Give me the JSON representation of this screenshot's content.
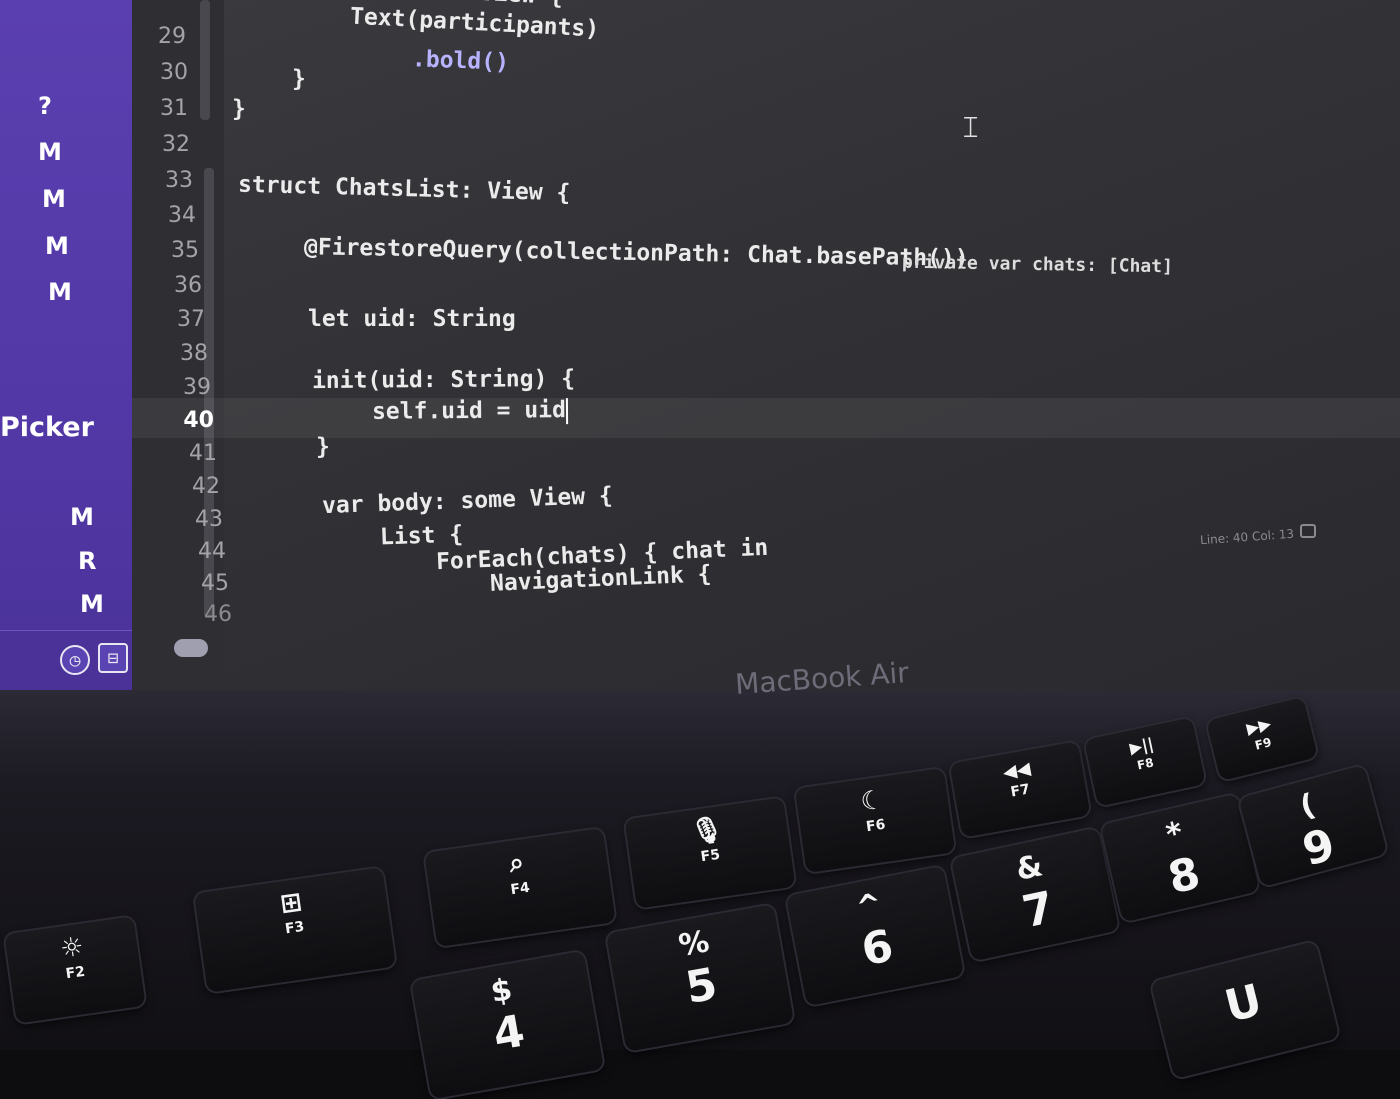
{
  "navigator": {
    "status_badges": [
      "?",
      "M",
      "M",
      "M",
      "M"
    ],
    "section_label": "Picker",
    "lower_badges": [
      "M",
      "R",
      "M"
    ]
  },
  "editor": {
    "line_numbers": [
      "29",
      "30",
      "31",
      "32",
      "33",
      "34",
      "35",
      "36",
      "37",
      "38",
      "39",
      "40",
      "41",
      "42",
      "43",
      "44",
      "45",
      "46"
    ],
    "active_line": "40",
    "lines": {
      "l28": "View {",
      "l29": "Text(participants)",
      "l30": ".bold()",
      "l30b": "}",
      "l31": "}",
      "l33": "struct ChatsList: View {",
      "l35a": "@FirestoreQuery(collectionPath: Chat.basePath())",
      "l35b": "private var chats: [Chat]",
      "l37": "let uid: String",
      "l39": "init(uid: String) {",
      "l40": "self.uid = uid",
      "l41": "}",
      "l43": "var body: some View {",
      "l44": "List {",
      "l45": "ForEach(chats) { chat in",
      "l46": "NavigationLink {"
    },
    "status_text": "Line: 40  Col: 13"
  },
  "laptop": {
    "brand": "MacBook Air",
    "function_keys": [
      {
        "sym": "☼",
        "label": "F2"
      },
      {
        "sym": "⊞",
        "label": "F3"
      },
      {
        "sym": "⌕",
        "label": "F4"
      },
      {
        "sym": "🎙",
        "label": "F5"
      },
      {
        "sym": "☾",
        "label": "F6"
      },
      {
        "sym": "◀◀",
        "label": "F7"
      },
      {
        "sym": "▶||",
        "label": "F8"
      },
      {
        "sym": "▶▶",
        "label": "F9"
      }
    ],
    "number_keys": [
      {
        "top": "$",
        "main": "4"
      },
      {
        "top": "%",
        "main": "5"
      },
      {
        "top": "^",
        "main": "6"
      },
      {
        "top": "&",
        "main": "7"
      },
      {
        "top": "*",
        "main": "8"
      },
      {
        "top": "(",
        "main": "9"
      }
    ],
    "letter_key": "U"
  }
}
